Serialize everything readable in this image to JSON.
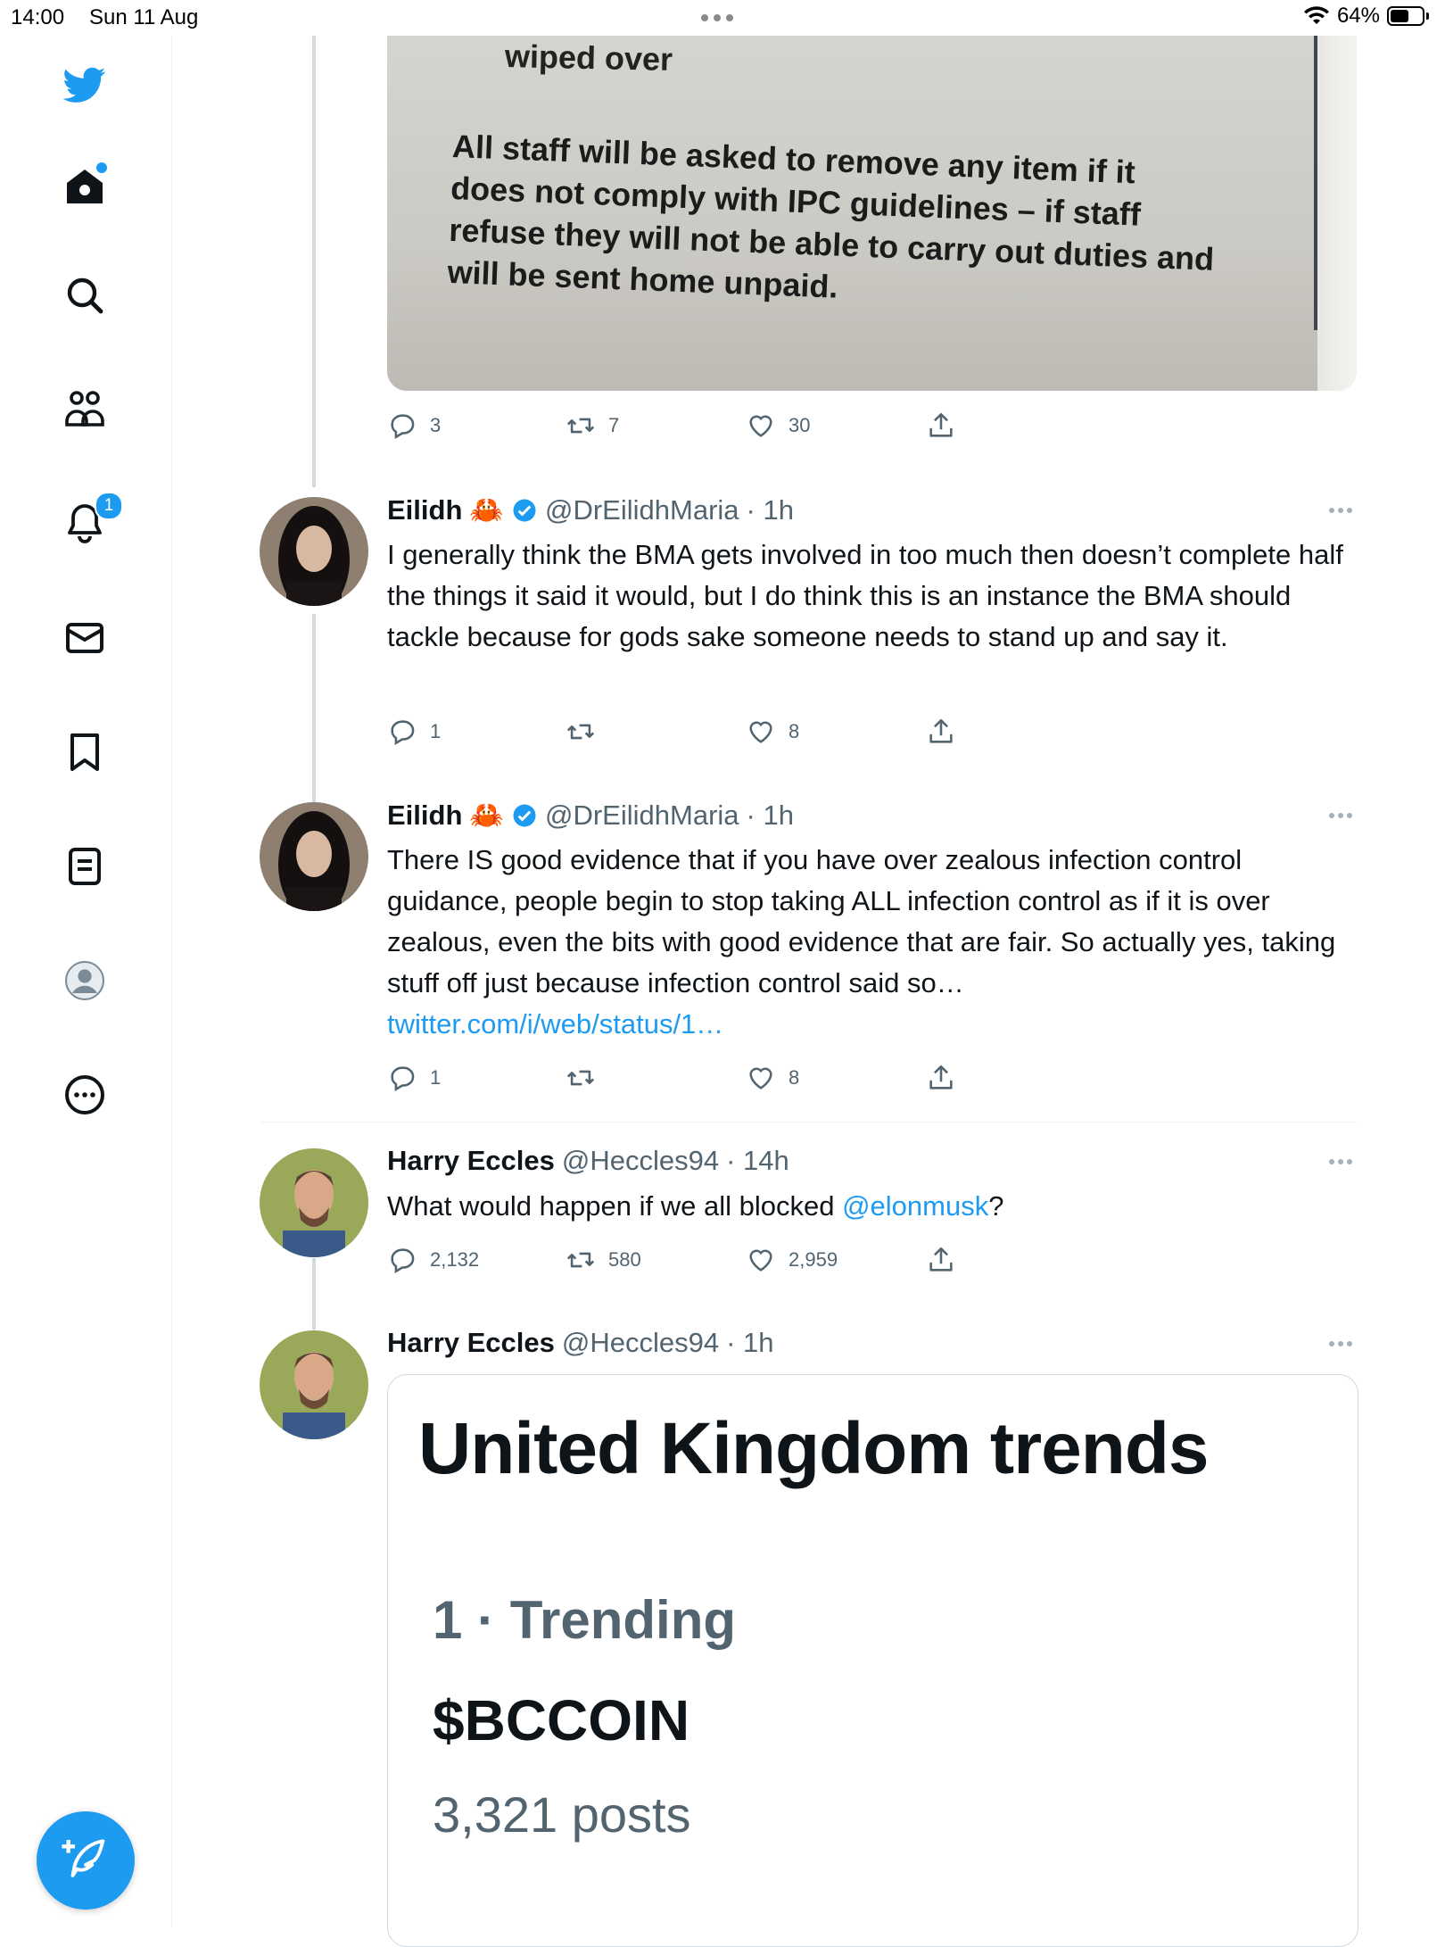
{
  "status_bar": {
    "time": "14:00",
    "date": "Sun 11 Aug",
    "battery": "64%",
    "battery_level": 0.64
  },
  "sidebar": {
    "notifications_badge": "1",
    "icons": [
      "twitter-bird-icon",
      "home-icon",
      "search-icon",
      "communities-icon",
      "bell-icon",
      "mail-icon",
      "bookmark-icon",
      "lists-icon",
      "profile-icon",
      "more-icon",
      "compose-icon"
    ]
  },
  "colors": {
    "accent": "#1d9bf0",
    "text": "#0f1419",
    "muted": "#536471",
    "border": "#eff3f4"
  },
  "image_sign": {
    "line1": "wiped over",
    "body": "All staff will be asked to remove any item if it does not comply with IPC guidelines – if staff refuse they will not be able to carry out duties and will be sent home unpaid."
  },
  "first_actions": {
    "replies": "3",
    "retweets": "7",
    "likes": "30"
  },
  "tweets": [
    {
      "name": "Eilidh",
      "emoji": "🦀",
      "handle": "@DrEilidhMaria",
      "time": "· 1h",
      "text": "I generally think the BMA gets involved in too much then doesn’t complete half the things it said it would, but I do think this is an instance the BMA should tackle because for gods sake someone needs to stand up and say it.",
      "replies": "1",
      "retweets": "",
      "likes": "8"
    },
    {
      "name": "Eilidh",
      "emoji": "🦀",
      "handle": "@DrEilidhMaria",
      "time": "· 1h",
      "text": "There IS good evidence that if you have over zealous infection control guidance, people begin to stop taking ALL infection control as if it is over zealous, even the bits with good evidence that are fair. So actually yes, taking stuff off just because infection control said so…",
      "link": "twitter.com/i/web/status/1…",
      "replies": "1",
      "retweets": "",
      "likes": "8"
    },
    {
      "name": "Harry Eccles",
      "handle": "@Heccles94",
      "time": "· 14h",
      "text_before": "What would happen if we all blocked ",
      "mention": "@elonmusk",
      "text_after": "?",
      "replies": "2,132",
      "retweets": "580",
      "likes": "2,959"
    },
    {
      "name": "Harry Eccles",
      "handle": "@Heccles94",
      "time": "· 1h"
    }
  ],
  "trend_card": {
    "title": "United Kingdom trends",
    "rank": "1 · Trending",
    "name": "$BCCOIN",
    "posts": "3,321 posts"
  }
}
